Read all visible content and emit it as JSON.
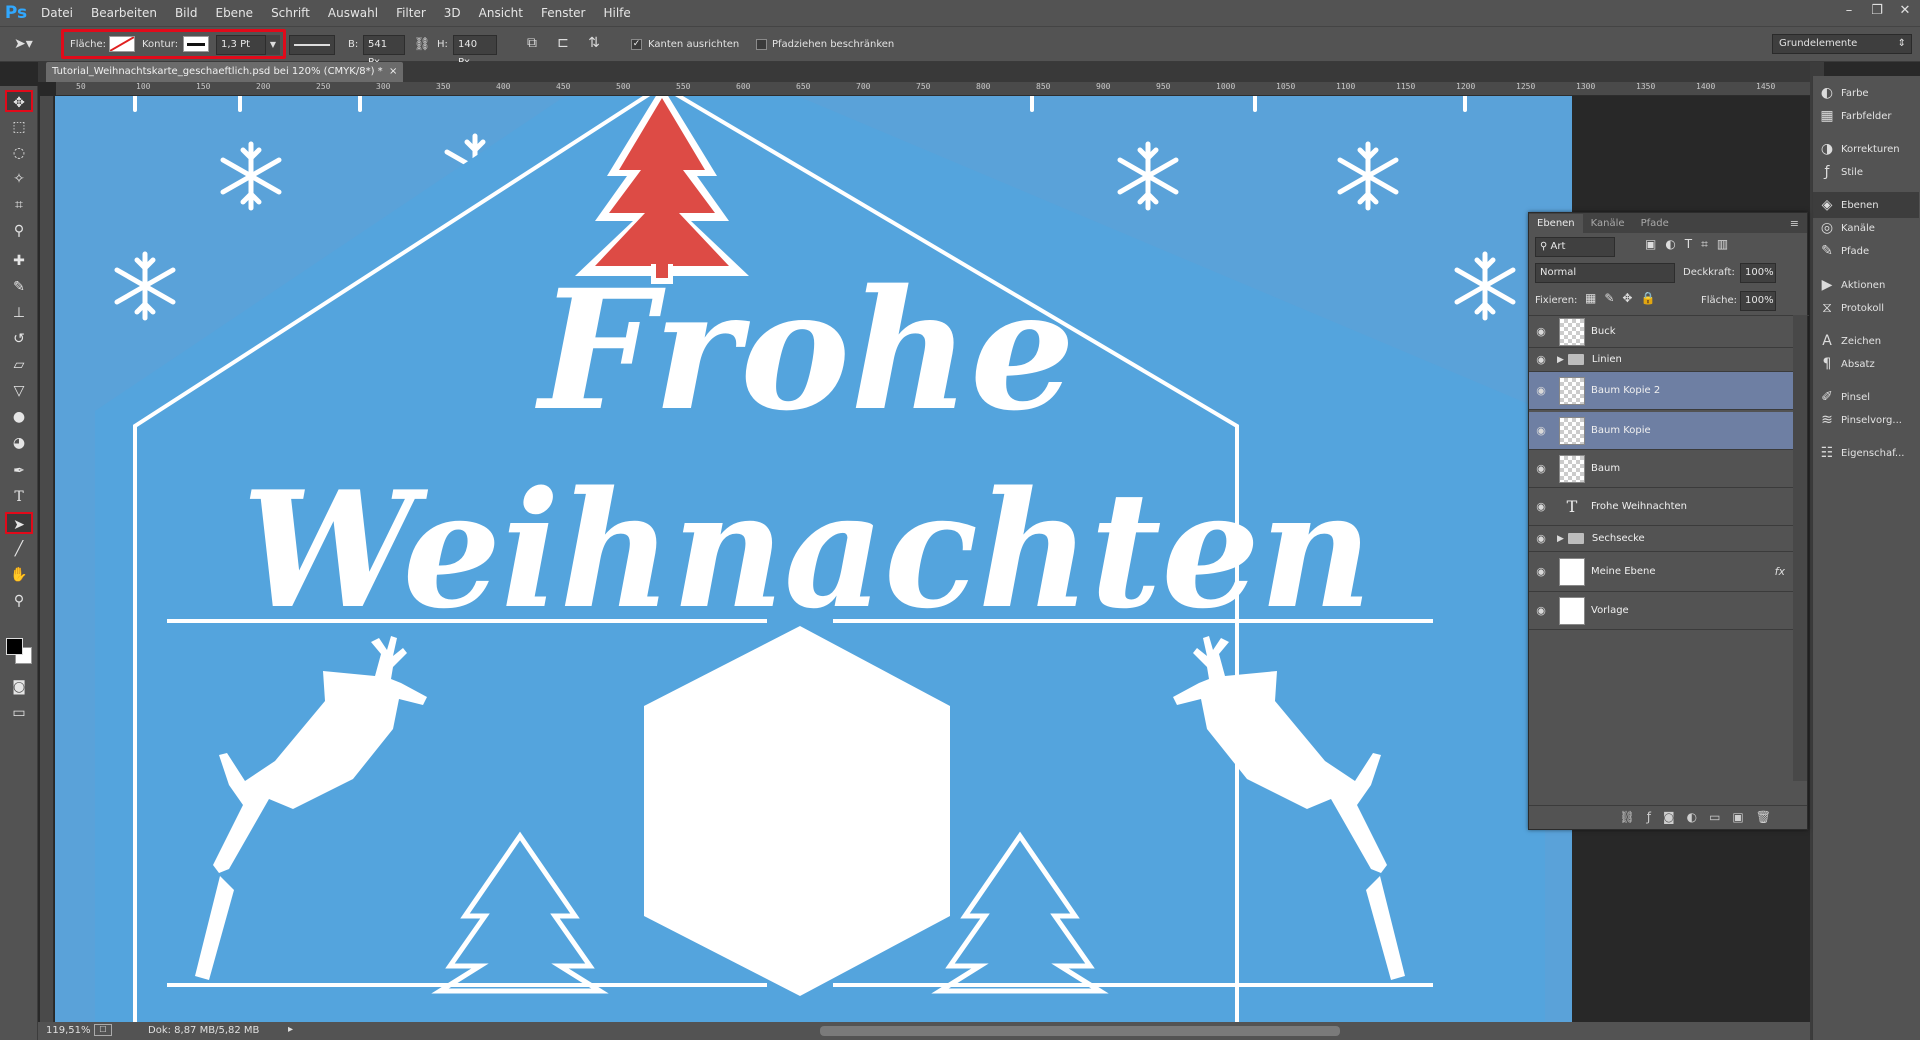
{
  "app": {
    "logo": "Ps"
  },
  "menu": [
    "Datei",
    "Bearbeiten",
    "Bild",
    "Ebene",
    "Schrift",
    "Auswahl",
    "Filter",
    "3D",
    "Ansicht",
    "Fenster",
    "Hilfe"
  ],
  "window_controls": [
    "–",
    "❐",
    "✕"
  ],
  "options": {
    "flaeche_label": "Fläche:",
    "kontur_label": "Kontur:",
    "stroke_width": "1,3 Pt",
    "b_label": "B:",
    "b_value": "541 Px",
    "h_label": "H:",
    "h_value": "140 Px",
    "kanten_label": "Kanten ausrichten",
    "kanten_checked": true,
    "pfad_label": "Pfadziehen beschränken",
    "pfad_checked": false,
    "workspace": "Grundelemente"
  },
  "document": {
    "tab_title": "Tutorial_Weihnachtskarte_geschaeftlich.psd bei 120% (CMYK/8*) *",
    "close": "×",
    "ruler_ticks": [
      "50",
      "100",
      "150",
      "200",
      "250",
      "300",
      "350",
      "400",
      "450",
      "500",
      "550",
      "600",
      "650",
      "700",
      "750",
      "800",
      "850",
      "900",
      "950",
      "1000",
      "1050",
      "1100",
      "1150",
      "1200",
      "1250",
      "1300",
      "1350",
      "1400",
      "1450"
    ]
  },
  "canvas": {
    "line1": "Frohe",
    "line2": "Weihnachten",
    "colors": {
      "background": "#5aa2d9",
      "house": "#54a4dd",
      "tree_red": "#dd4b45",
      "white": "#ffffff"
    }
  },
  "status": {
    "zoom": "119,51%",
    "doc": "Dok: 8,87 MB/5,82 MB"
  },
  "dock": [
    {
      "icon": "palette-icon",
      "glyph": "◐",
      "label": "Farbe"
    },
    {
      "icon": "swatches-icon",
      "glyph": "▦",
      "label": "Farbfelder"
    },
    {
      "icon": "adjustments-icon",
      "glyph": "◑",
      "label": "Korrekturen"
    },
    {
      "icon": "styles-icon",
      "glyph": "ƒ",
      "label": "Stile"
    },
    {
      "icon": "layers-icon",
      "glyph": "◈",
      "label": "Ebenen",
      "active": true
    },
    {
      "icon": "channels-icon",
      "glyph": "◎",
      "label": "Kanäle"
    },
    {
      "icon": "paths-icon",
      "glyph": "✎",
      "label": "Pfade"
    },
    {
      "icon": "actions-icon",
      "glyph": "▶",
      "label": "Aktionen"
    },
    {
      "icon": "history-icon",
      "glyph": "⧖",
      "label": "Protokoll"
    },
    {
      "icon": "character-icon",
      "glyph": "A",
      "label": "Zeichen"
    },
    {
      "icon": "paragraph-icon",
      "glyph": "¶",
      "label": "Absatz"
    },
    {
      "icon": "brush-icon",
      "glyph": "✐",
      "label": "Pinsel"
    },
    {
      "icon": "brush-presets-icon",
      "glyph": "≋",
      "label": "Pinselvorg..."
    },
    {
      "icon": "properties-icon",
      "glyph": "☷",
      "label": "Eigenschaf..."
    }
  ],
  "layers_panel": {
    "tabs": [
      "Ebenen",
      "Kanäle",
      "Pfade"
    ],
    "filter": "Art",
    "blend_mode": "Normal",
    "opacity_label": "Deckkraft:",
    "opacity": "100%",
    "lock_label": "Fixieren:",
    "fill_label": "Fläche:",
    "fill": "100%",
    "fx": "fx",
    "layers": [
      {
        "name": "Buck",
        "kind": "checker",
        "selected": false
      },
      {
        "name": "Linien",
        "kind": "folder",
        "selected": false
      },
      {
        "name": "Baum Kopie 2",
        "kind": "checker",
        "selected": true
      },
      {
        "name": "Baum Kopie",
        "kind": "checker",
        "selected": true
      },
      {
        "name": "Baum",
        "kind": "checker",
        "selected": false
      },
      {
        "name": "Frohe Weihnachten",
        "kind": "text",
        "selected": false
      },
      {
        "name": "Sechsecke",
        "kind": "folder",
        "selected": false
      },
      {
        "name": "Meine Ebene",
        "kind": "white",
        "selected": false,
        "fx": true
      },
      {
        "name": "Vorlage",
        "kind": "white",
        "selected": false
      }
    ]
  }
}
